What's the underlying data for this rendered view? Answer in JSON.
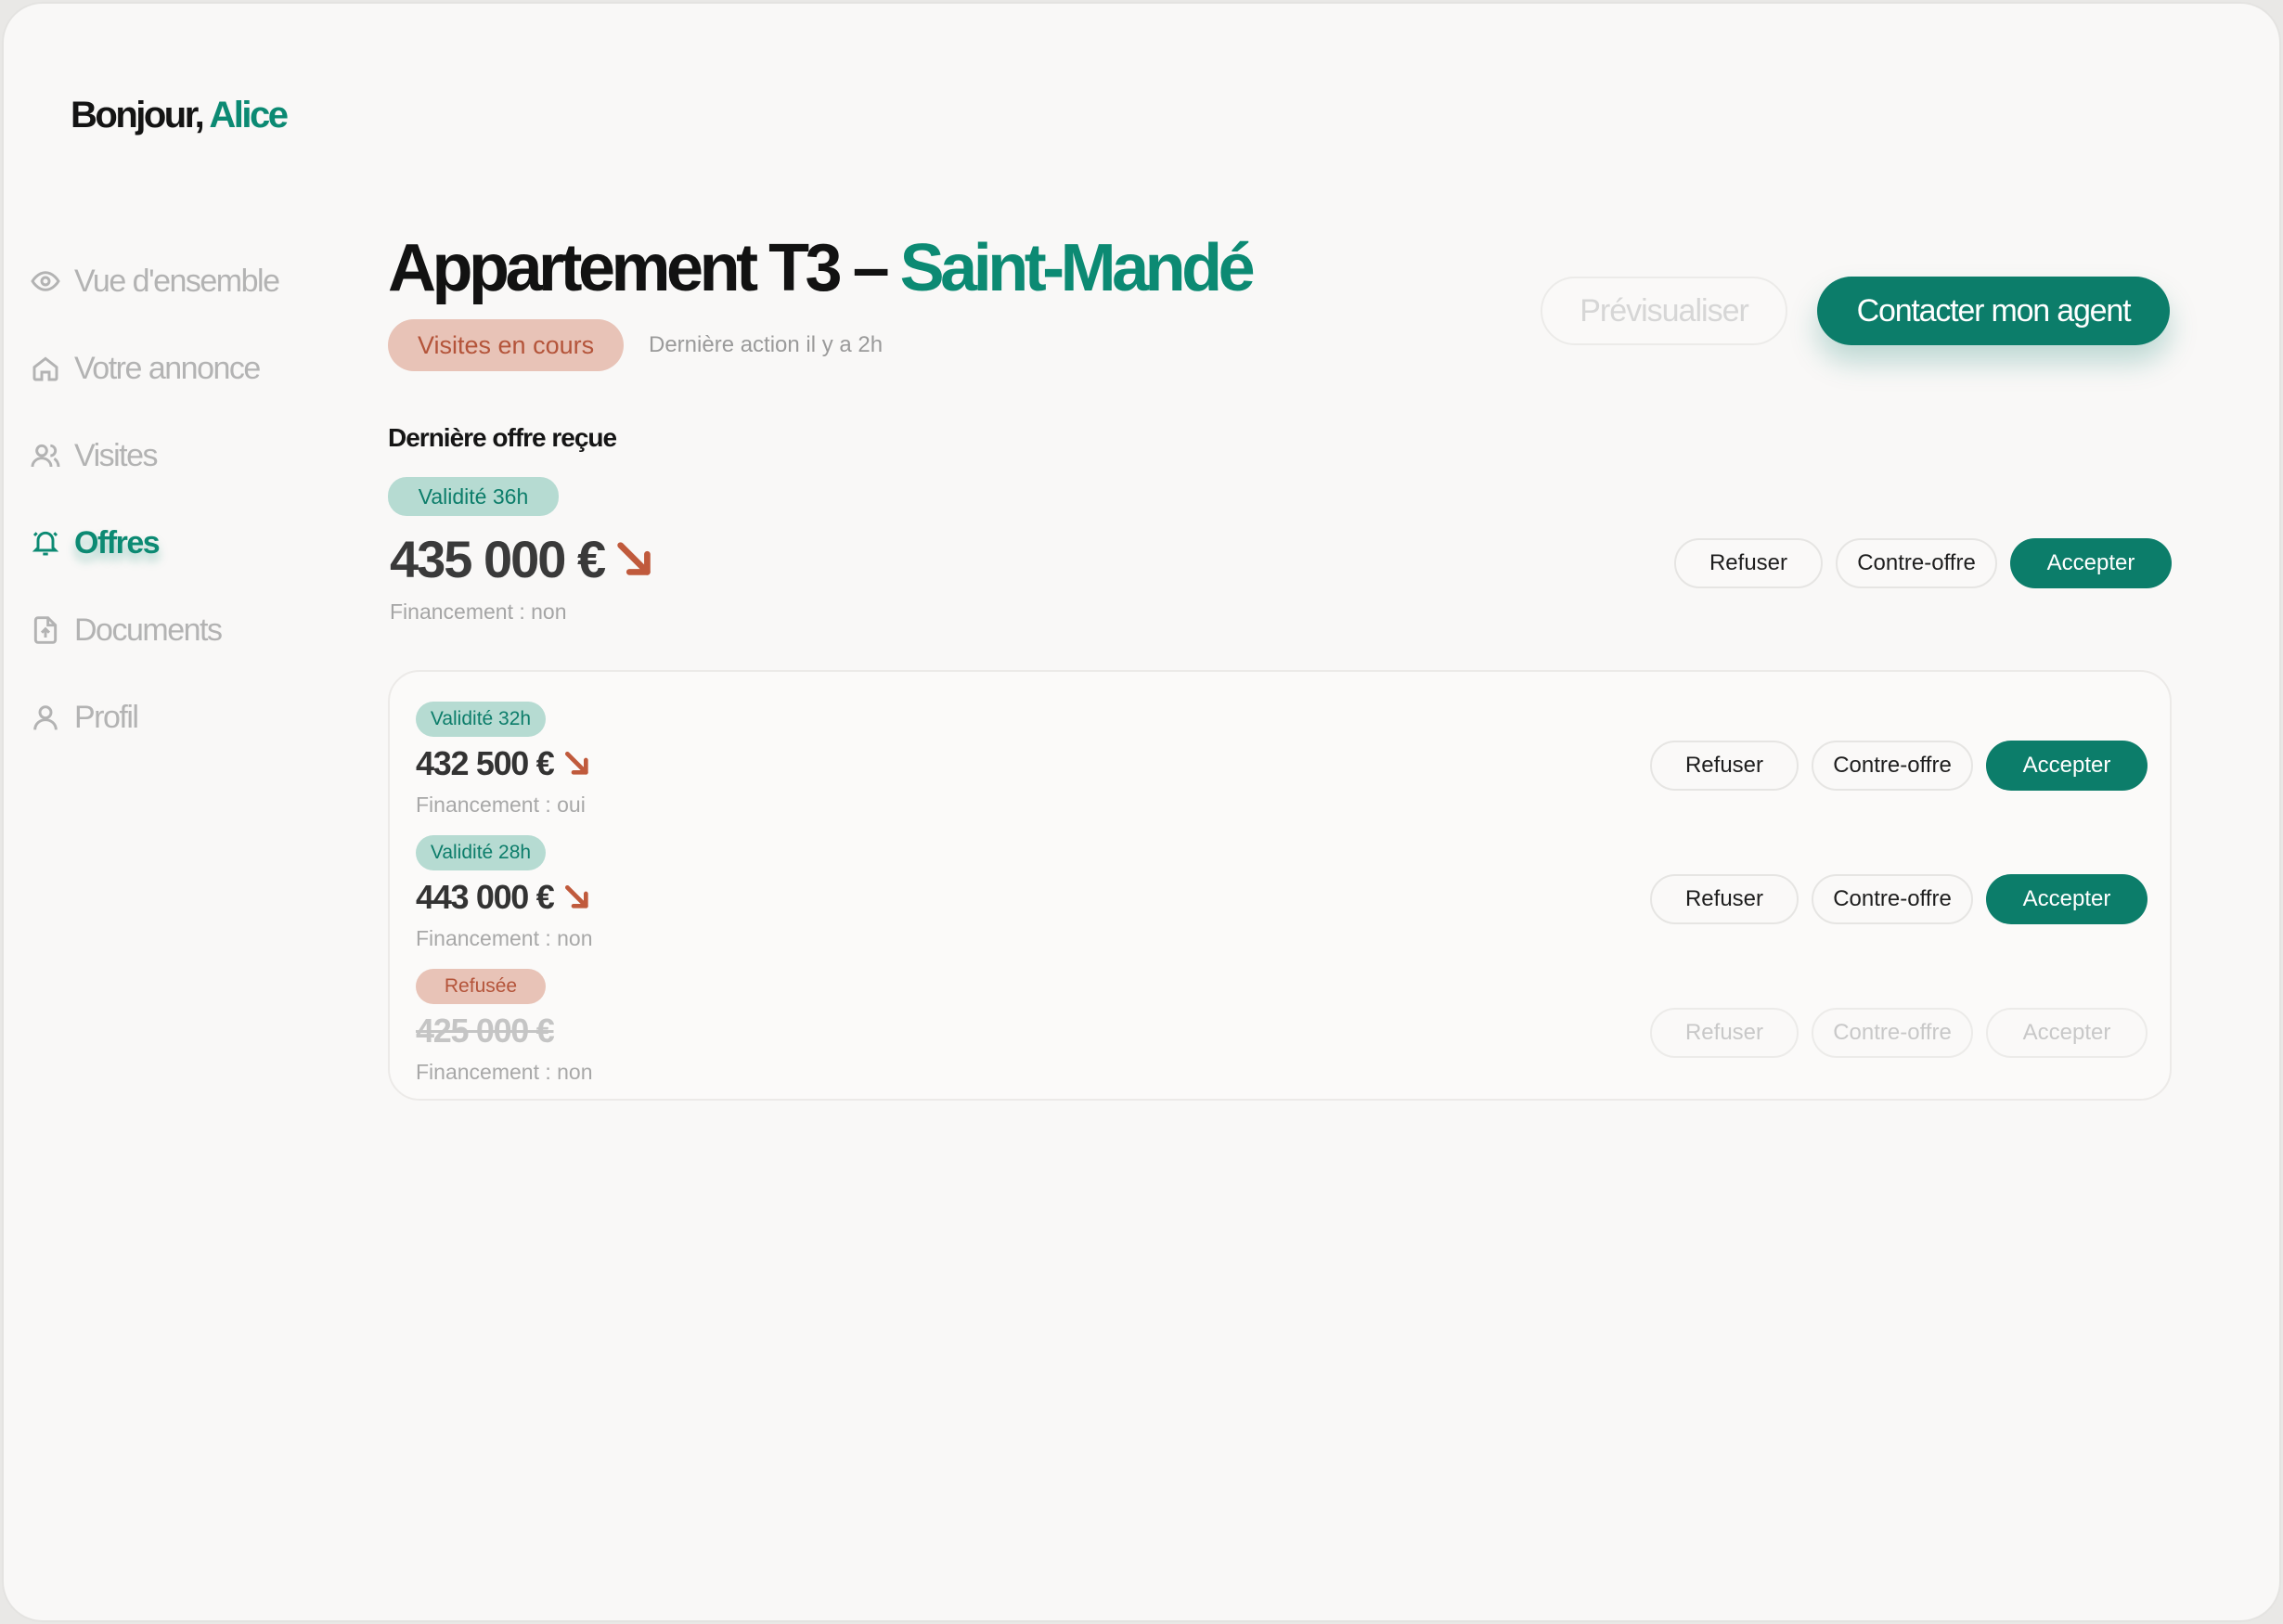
{
  "greeting": {
    "prefix": "Bonjour,",
    "name": "Alice"
  },
  "nav": [
    {
      "label": "Vue d'ensemble",
      "icon": "eye-icon",
      "active": false
    },
    {
      "label": "Votre annonce",
      "icon": "home-icon",
      "active": false
    },
    {
      "label": "Visites",
      "icon": "users-icon",
      "active": false
    },
    {
      "label": "Offres",
      "icon": "bell-icon",
      "active": true
    },
    {
      "label": "Documents",
      "icon": "document-upload-icon",
      "active": false
    },
    {
      "label": "Profil",
      "icon": "user-icon",
      "active": false
    }
  ],
  "header": {
    "title_main": "Appartement T3 –",
    "title_accent": "Saint-Mandé",
    "status": "Visites en cours",
    "last_action": "Dernière action il y a 2h",
    "preview_label": "Prévisualiser",
    "contact_label": "Contacter mon agent"
  },
  "latest_offer": {
    "section_title": "Dernière offre reçue",
    "badge": "Validité 36h",
    "amount": "435 000 €",
    "trend": "down",
    "financing": "Financement : non"
  },
  "actions": {
    "refuse": "Refuser",
    "counter": "Contre-offre",
    "accept": "Accepter"
  },
  "offers": [
    {
      "badge": "Validité 32h",
      "badge_type": "valid",
      "amount": "432 500 €",
      "trend": "down",
      "financing": "Financement : oui",
      "disabled": false
    },
    {
      "badge": "Validité 28h",
      "badge_type": "valid",
      "amount": "443 000 €",
      "trend": "down",
      "financing": "Financement : non",
      "disabled": false
    },
    {
      "badge": "Refusée",
      "badge_type": "refused",
      "amount": "425 000 €",
      "trend": "none",
      "financing": "Financement : non",
      "disabled": true
    }
  ],
  "colors": {
    "accent": "#0c8a73",
    "accent_dark": "#0c7d6a",
    "warning": "#b4543a"
  }
}
